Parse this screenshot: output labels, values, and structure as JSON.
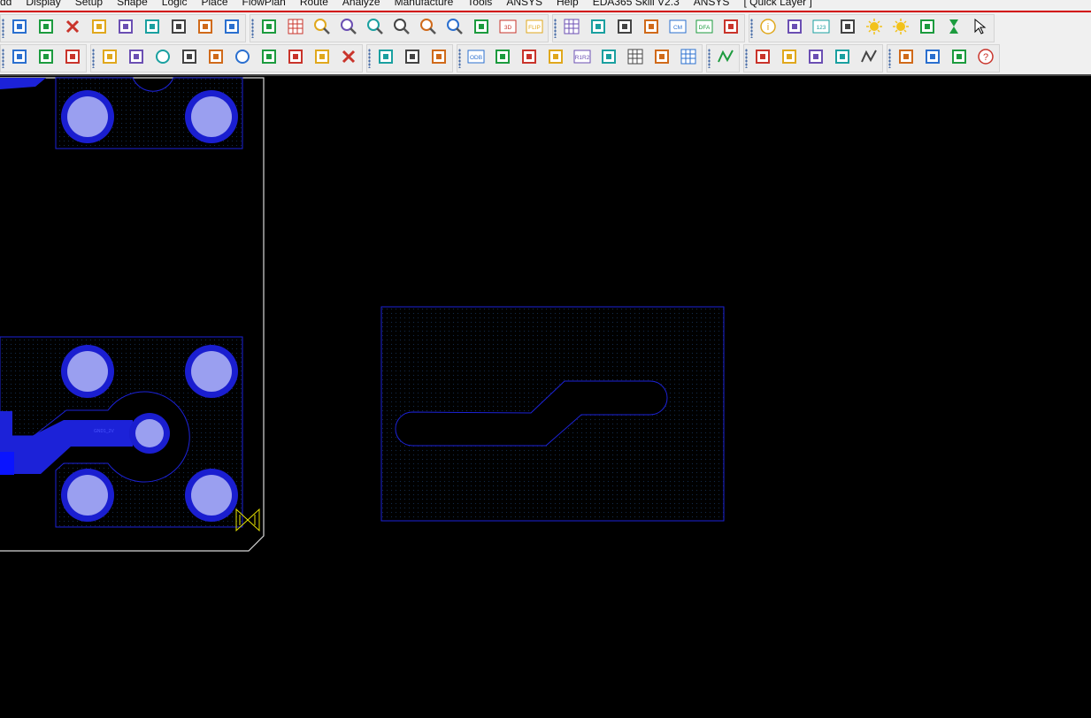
{
  "menu": [
    "dd",
    "Display",
    "Setup",
    "Shape",
    "Logic",
    "Place",
    "FlowPlan",
    "Route",
    "Analyze",
    "Manufacture",
    "Tools",
    "ANSYS",
    "Help",
    "EDA365 Skill V2.3",
    "ANSYS",
    "[ Quick Layer ]"
  ],
  "toolbar1": [
    {
      "name": "move-icon"
    },
    {
      "name": "copy-icon"
    },
    {
      "name": "delete-icon"
    },
    {
      "name": "undo-icon"
    },
    {
      "name": "step-down-icon"
    },
    {
      "name": "redo-icon"
    },
    {
      "name": "step-down2-icon"
    },
    {
      "name": "add-connect-icon"
    },
    {
      "name": "pin-icon"
    },
    {
      "name": "unrats-icon"
    },
    {
      "name": "grid-view-icon"
    },
    {
      "name": "zoom-fit-icon"
    },
    {
      "name": "zoom-window-icon"
    },
    {
      "name": "zoom-in-icon"
    },
    {
      "name": "zoom-out-icon"
    },
    {
      "name": "zoom-previous-icon"
    },
    {
      "name": "zoom-world-icon"
    },
    {
      "name": "redraw-icon"
    },
    {
      "name": "view-3d-icon",
      "label": "3D"
    },
    {
      "name": "flip-icon",
      "label": "FLIP"
    },
    {
      "name": "grid-icon"
    },
    {
      "name": "color-palette-icon"
    },
    {
      "name": "layers-icon"
    },
    {
      "name": "stackup-icon"
    },
    {
      "name": "cm-icon",
      "label": "CM"
    },
    {
      "name": "dfa-icon",
      "label": "DFA"
    },
    {
      "name": "chip-icon"
    },
    {
      "name": "info-icon"
    },
    {
      "name": "status-icon"
    },
    {
      "name": "measure-icon",
      "label": "123"
    },
    {
      "name": "brush-icon"
    },
    {
      "name": "highlight-icon"
    },
    {
      "name": "dehighlight-icon"
    },
    {
      "name": "bars-icon"
    },
    {
      "name": "hourglass-icon"
    },
    {
      "name": "cursor-icon"
    }
  ],
  "toolbar2": [
    {
      "name": "board-icon"
    },
    {
      "name": "shape-gray-icon"
    },
    {
      "name": "shape-green-icon"
    },
    {
      "name": "shape-polygon-icon"
    },
    {
      "name": "shape-rect-icon"
    },
    {
      "name": "shape-circle-icon"
    },
    {
      "name": "shape-select-icon"
    },
    {
      "name": "shape-void-icon"
    },
    {
      "name": "shape-void-circle-icon"
    },
    {
      "name": "shape-edit-icon"
    },
    {
      "name": "shape-merge-icon"
    },
    {
      "name": "shape-compose-icon"
    },
    {
      "name": "delete-island-icon"
    },
    {
      "name": "place-icon"
    },
    {
      "name": "dimension-icon"
    },
    {
      "name": "dimension2-icon"
    },
    {
      "name": "odb-icon",
      "label": "ODB"
    },
    {
      "name": "artwork-icon"
    },
    {
      "name": "drill-icon"
    },
    {
      "name": "camera-icon"
    },
    {
      "name": "ncdrill-icon",
      "label": "R1R2"
    },
    {
      "name": "legend-icon"
    },
    {
      "name": "matrix-icon"
    },
    {
      "name": "testpoint-icon"
    },
    {
      "name": "array-icon"
    },
    {
      "name": "route-icon"
    },
    {
      "name": "report-icon"
    },
    {
      "name": "book-icon"
    },
    {
      "name": "bom-icon"
    },
    {
      "name": "check-icon"
    },
    {
      "name": "wave-icon"
    },
    {
      "name": "window-icon"
    },
    {
      "name": "mail-icon"
    },
    {
      "name": "envelope-icon"
    },
    {
      "name": "help-icon"
    }
  ],
  "pad_label": "GND1_2V"
}
